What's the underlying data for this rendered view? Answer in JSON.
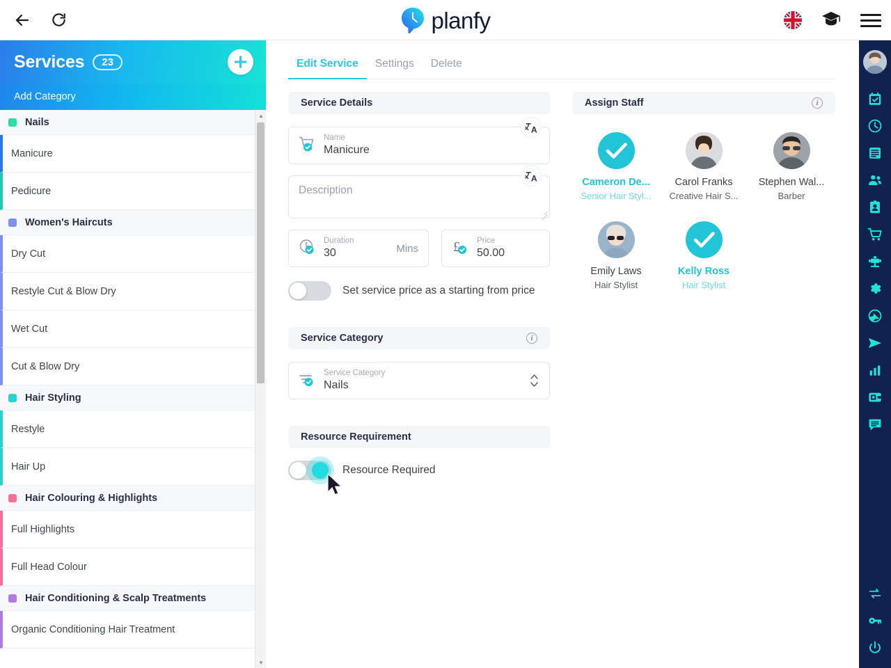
{
  "browser": {
    "back_label": "Back",
    "reload_label": "Reload"
  },
  "header": {
    "brand": "planfy",
    "logo_icon": "planfy-pin-clock-logo",
    "language_flag": "uk-flag-icon",
    "academy_icon": "graduation-cap-icon",
    "menu_icon": "hamburger-menu-icon"
  },
  "sidebar": {
    "title": "Services",
    "count": "23",
    "add_service_label": "+",
    "add_category_label": "Add Category",
    "groups": [
      {
        "category": "Nails",
        "color": "#2adda0",
        "services": [
          {
            "name": "Manicure",
            "selected": true,
            "accent": "#2979e8"
          },
          {
            "name": "Pedicure",
            "selected": false,
            "accent": "#20c9b0"
          }
        ]
      },
      {
        "category": "Women's Haircuts",
        "color": "#7d8ff0",
        "services": [
          {
            "name": "Dry Cut",
            "selected": false,
            "accent": "#7d8ff0"
          },
          {
            "name": "Restyle Cut & Blow Dry",
            "selected": false,
            "accent": "#7d8ff0"
          },
          {
            "name": "Wet Cut",
            "selected": false,
            "accent": "#7d8ff0"
          },
          {
            "name": "Cut & Blow Dry",
            "selected": false,
            "accent": "#7d8ff0"
          }
        ]
      },
      {
        "category": "Hair Styling",
        "color": "#2ad1d1",
        "services": [
          {
            "name": "Restyle",
            "selected": false,
            "accent": "#2ad1d1"
          },
          {
            "name": "Hair Up",
            "selected": false,
            "accent": "#2ad1d1"
          }
        ]
      },
      {
        "category": "Hair Colouring & Highlights",
        "color": "#f4709b",
        "services": [
          {
            "name": "Full Highlights",
            "selected": false,
            "accent": "#f4709b"
          },
          {
            "name": "Full Head Colour",
            "selected": false,
            "accent": "#f4709b"
          }
        ]
      },
      {
        "category": "Hair Conditioning & Scalp Treatments",
        "color": "#b07ae0",
        "services": [
          {
            "name": "Organic Conditioning Hair Treatment",
            "selected": false,
            "accent": "#b07ae0"
          }
        ]
      }
    ]
  },
  "tabs": [
    {
      "label": "Edit Service",
      "active": true
    },
    {
      "label": "Settings",
      "active": false
    },
    {
      "label": "Delete",
      "active": false
    }
  ],
  "service_details": {
    "section_title": "Service Details",
    "name": {
      "label": "Name",
      "value": "Manicure",
      "icon": "shopping-cart-icon"
    },
    "description": {
      "placeholder": "Description",
      "value": ""
    },
    "duration": {
      "label": "Duration",
      "value": "30",
      "suffix": "Mins",
      "icon": "clock-icon"
    },
    "price": {
      "label": "Price",
      "value": "50.00",
      "icon": "pound-sterling-icon"
    },
    "starting_price_toggle": {
      "label": "Set service price as a starting from price",
      "on": false
    },
    "translate_icon": "translate-icon"
  },
  "service_category": {
    "section_title": "Service Category",
    "field_label": "Service Category",
    "value": "Nails",
    "icon": "filter-lines-icon"
  },
  "resource_requirement": {
    "section_title": "Resource Requirement",
    "toggle_label": "Resource Required",
    "on": false
  },
  "assign_staff": {
    "section_title": "Assign Staff",
    "members": [
      {
        "name": "Cameron De...",
        "role": "Senior Hair Styl...",
        "selected": true
      },
      {
        "name": "Carol Franks",
        "role": "Creative Hair S...",
        "selected": false
      },
      {
        "name": "Stephen Wal...",
        "role": "Barber",
        "selected": false
      },
      {
        "name": "Emily Laws",
        "role": "Hair Stylist",
        "selected": false
      },
      {
        "name": "Kelly Ross",
        "role": "Hair Stylist",
        "selected": true
      }
    ]
  },
  "rail": {
    "avatar": "user-avatar",
    "icons": [
      "calendar-check-icon",
      "clock-icon",
      "receipt-list-icon",
      "people-icon",
      "contact-card-icon",
      "shopping-cart-icon",
      "salon-chair-icon",
      "gear-icon",
      "globe-icon",
      "send-icon",
      "bar-chart-icon",
      "wallet-icon",
      "chat-icon"
    ],
    "bottom_icons": [
      "transfer-icon",
      "key-icon",
      "power-icon"
    ]
  },
  "colors": {
    "accent_cyan": "#24cbe0",
    "accent_blue": "#2979e8",
    "rail_bg": "#12224e",
    "selected_teal": "#22c4d8"
  }
}
